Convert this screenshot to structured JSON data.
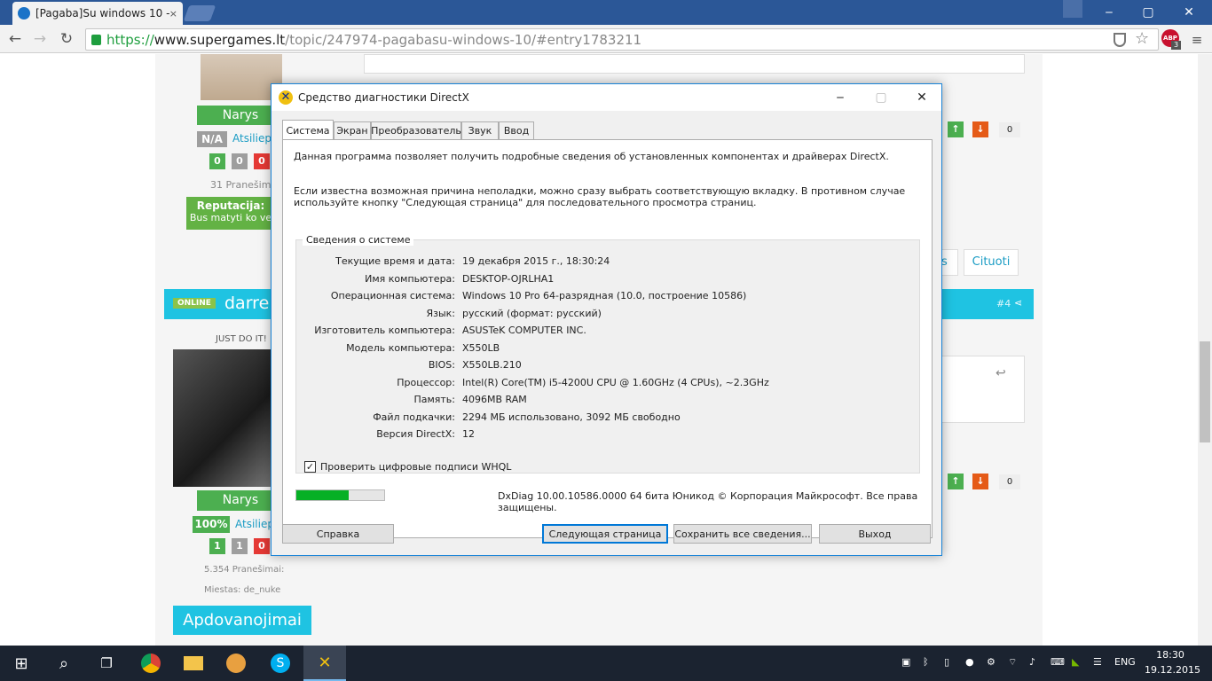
{
  "browser": {
    "tab_title": "[Pagaba]Su windows 10 - ",
    "tab_close": "×",
    "url_scheme": "https://",
    "url_domain": "www.supergames.lt",
    "url_path": "/topic/247974-pagabasu-windows-10/#entry1783211",
    "abp_label": "ABP",
    "abp_count": "3",
    "win_min": "‒",
    "win_max": "▢",
    "win_close": "✕"
  },
  "forum": {
    "user1": {
      "status": "Narys",
      "rating": "N/A",
      "rating_label": "Atsiliepi",
      "votes": [
        "0",
        "0",
        "0"
      ],
      "posts": "31 Pranešimai",
      "rep_title": "Reputacija:",
      "rep_text": "Bus matyti ko ve"
    },
    "post_score": "0",
    "quote_btn": "Cituoti",
    "quote_btn2": "s",
    "online": "ONLINE",
    "user2_name": "darrel",
    "post_no": "#4",
    "user2_motto": "JUST DO IT!",
    "user2": {
      "status": "Narys",
      "rating": "100%",
      "rating_label": "Atsiliepi",
      "votes": [
        "1",
        "1",
        "0"
      ],
      "posts": "5.354 Pranešimai:",
      "location": "Miestas: de_nuke"
    },
    "post_score2": "0",
    "awards": "Apdovanojimai"
  },
  "dialog": {
    "title": "Средство диагностики DirectX",
    "tabs": [
      "Система",
      "Экран",
      "Преобразователь",
      "Звук",
      "Ввод"
    ],
    "intro1": "Данная программа позволяет получить подробные сведения об установленных компонентах и драйверах DirectX.",
    "intro2": "Если известна возможная причина неполадки, можно сразу выбрать соответствующую вкладку. В противном случае используйте кнопку \"Следующая страница\" для последовательного просмотра страниц.",
    "group_title": "Сведения о системе",
    "rows": [
      {
        "label": "Текущие время и дата:",
        "value": "19 декабря 2015 г., 18:30:24"
      },
      {
        "label": "Имя компьютера:",
        "value": "DESKTOP-OJRLHA1"
      },
      {
        "label": "Операционная система:",
        "value": "Windows 10 Pro 64-разрядная (10.0, построение 10586)"
      },
      {
        "label": "Язык:",
        "value": "русский (формат: русский)"
      },
      {
        "label": "Изготовитель компьютера:",
        "value": "ASUSTeK COMPUTER INC."
      },
      {
        "label": "Модель компьютера:",
        "value": "X550LB"
      },
      {
        "label": "BIOS:",
        "value": "X550LB.210"
      },
      {
        "label": "Процессор:",
        "value": "Intel(R) Core(TM) i5-4200U CPU @ 1.60GHz (4 CPUs), ~2.3GHz"
      },
      {
        "label": "Память:",
        "value": "4096MB RAM"
      },
      {
        "label": "Файл подкачки:",
        "value": "2294 МБ использовано, 3092 МБ свободно"
      },
      {
        "label": "Версия DirectX:",
        "value": "12"
      }
    ],
    "whql_label": "Проверить цифровые подписи WHQL",
    "whql_checked": true,
    "progress": 0.6,
    "copyright": "DxDiag 10.00.10586.0000 64 бита Юникод © Корпорация Майкрософт. Все права защищены.",
    "btn_help": "Справка",
    "btn_next": "Следующая страница",
    "btn_save": "Сохранить все сведения...",
    "btn_exit": "Выход"
  },
  "taskbar": {
    "lang": "ENG",
    "time": "18:30",
    "date": "19.12.2015"
  },
  "colors": {
    "accent": "#1fc3e2",
    "green": "#4caf50",
    "progress": "#06b025",
    "titlebar_border": "#1883d7"
  }
}
